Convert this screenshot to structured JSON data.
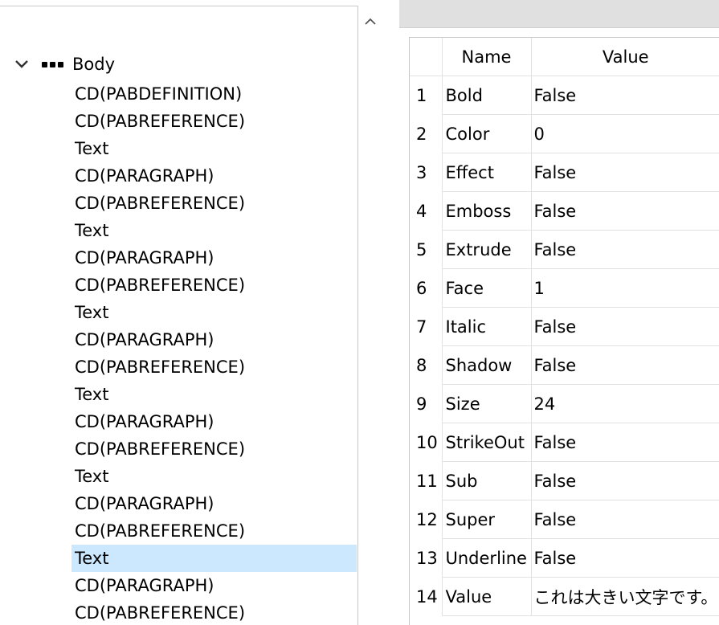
{
  "tree": {
    "root_label": "Body",
    "items": [
      "CD(PABDEFINITION)",
      "CD(PABREFERENCE)",
      "Text",
      "CD(PARAGRAPH)",
      "CD(PABREFERENCE)",
      "Text",
      "CD(PARAGRAPH)",
      "CD(PABREFERENCE)",
      "Text",
      "CD(PARAGRAPH)",
      "CD(PABREFERENCE)",
      "Text",
      "CD(PARAGRAPH)",
      "CD(PABREFERENCE)",
      "Text",
      "CD(PARAGRAPH)",
      "CD(PABREFERENCE)",
      "Text",
      "CD(PARAGRAPH)",
      "CD(PABREFERENCE)"
    ],
    "selected_index": 17
  },
  "grid": {
    "headers": {
      "name": "Name",
      "value": "Value"
    },
    "rows": [
      {
        "num": "1",
        "name": "Bold",
        "value": "False"
      },
      {
        "num": "2",
        "name": "Color",
        "value": "0"
      },
      {
        "num": "3",
        "name": "Effect",
        "value": "False"
      },
      {
        "num": "4",
        "name": "Emboss",
        "value": "False"
      },
      {
        "num": "5",
        "name": "Extrude",
        "value": "False"
      },
      {
        "num": "6",
        "name": "Face",
        "value": "1"
      },
      {
        "num": "7",
        "name": "Italic",
        "value": "False"
      },
      {
        "num": "8",
        "name": "Shadow",
        "value": "False"
      },
      {
        "num": "9",
        "name": "Size",
        "value": "24"
      },
      {
        "num": "10",
        "name": "StrikeOut",
        "value": "False"
      },
      {
        "num": "11",
        "name": "Sub",
        "value": "False"
      },
      {
        "num": "12",
        "name": "Super",
        "value": "False"
      },
      {
        "num": "13",
        "name": "Underline",
        "value": "False"
      },
      {
        "num": "14",
        "name": "Value",
        "value": "これは大きい文字です。"
      }
    ]
  },
  "icons": {
    "expand": "chevron-down-icon",
    "node": "node-dots-icon",
    "scroll_up": "chevron-up-icon"
  },
  "colors": {
    "selection": "#cce8ff",
    "header_bar": "#e0e0e0"
  }
}
